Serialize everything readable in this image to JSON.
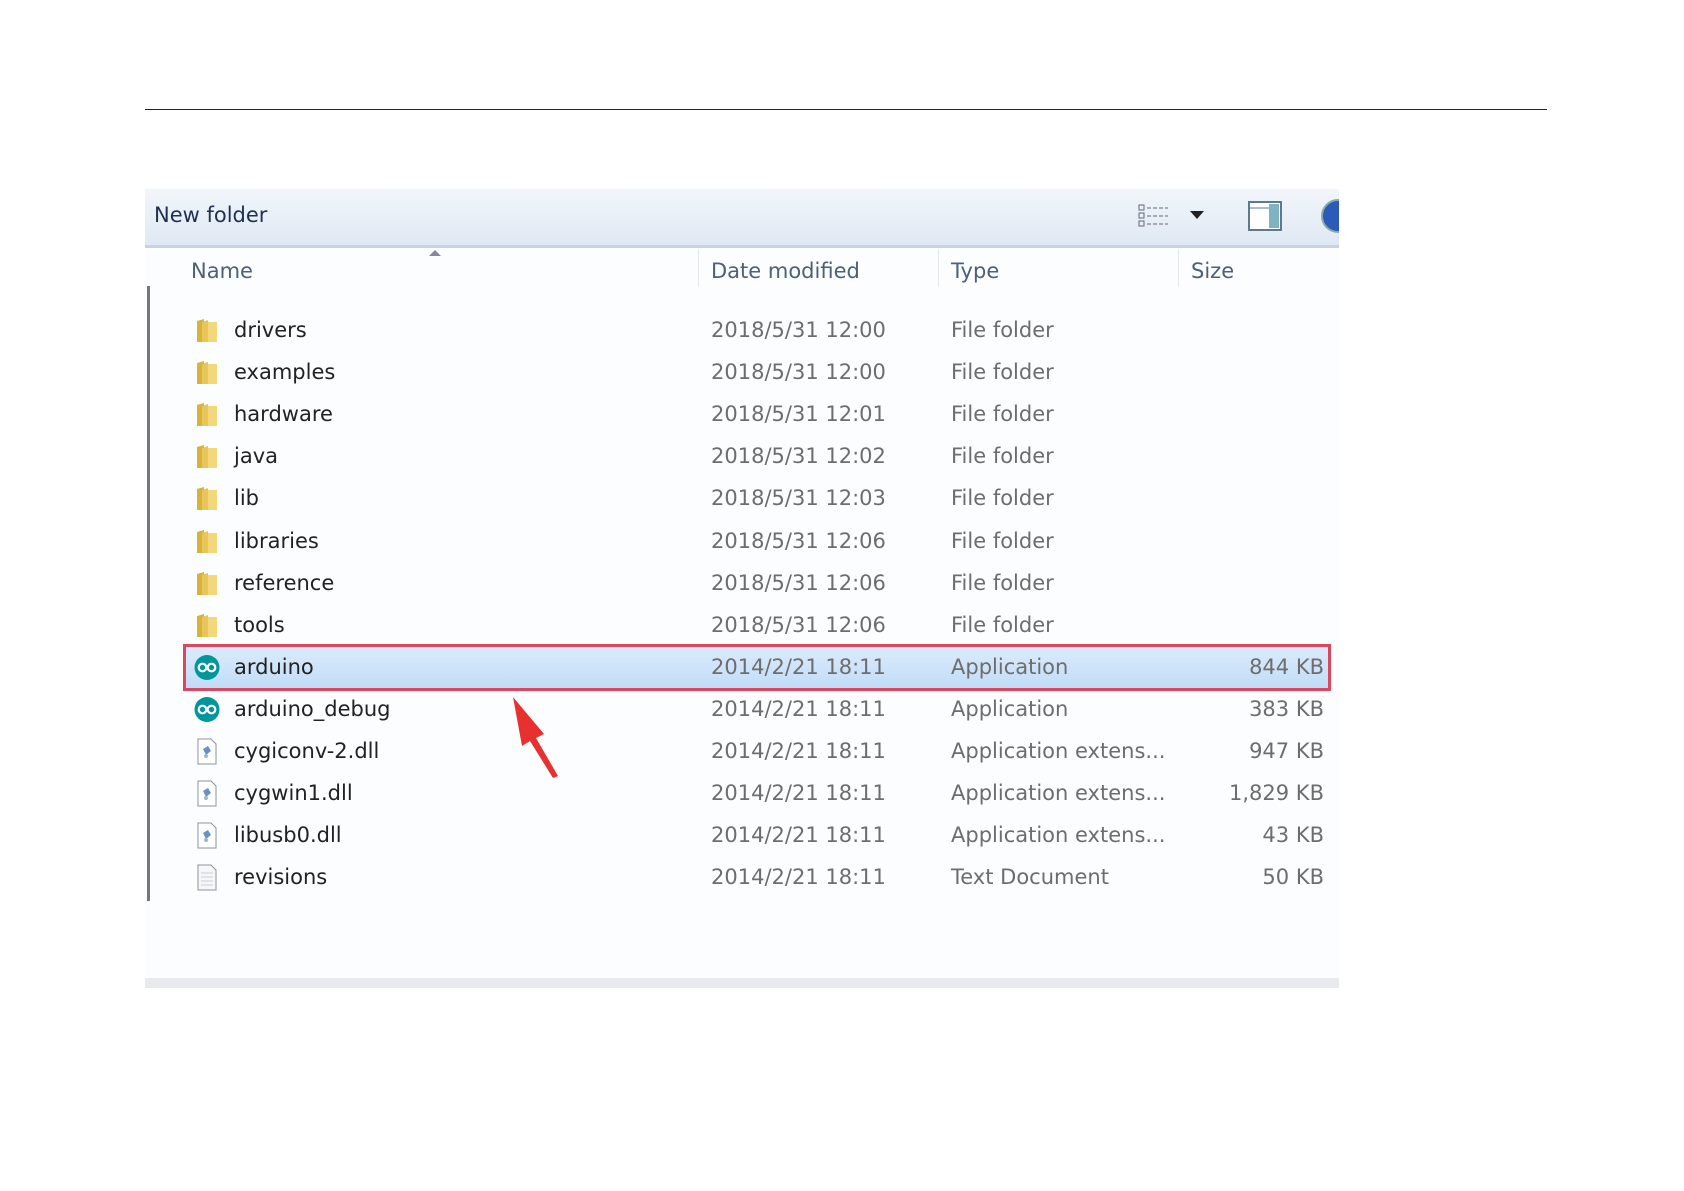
{
  "window": {
    "title": "New folder"
  },
  "columns": {
    "name": "Name",
    "date": "Date modified",
    "type": "Type",
    "size": "Size"
  },
  "files": [
    {
      "name": "drivers",
      "date": "2018/5/31 12:00",
      "type": "File folder",
      "size": "",
      "icon": "folder"
    },
    {
      "name": "examples",
      "date": "2018/5/31 12:00",
      "type": "File folder",
      "size": "",
      "icon": "folder"
    },
    {
      "name": "hardware",
      "date": "2018/5/31 12:01",
      "type": "File folder",
      "size": "",
      "icon": "folder"
    },
    {
      "name": "java",
      "date": "2018/5/31 12:02",
      "type": "File folder",
      "size": "",
      "icon": "folder"
    },
    {
      "name": "lib",
      "date": "2018/5/31 12:03",
      "type": "File folder",
      "size": "",
      "icon": "folder"
    },
    {
      "name": "libraries",
      "date": "2018/5/31 12:06",
      "type": "File folder",
      "size": "",
      "icon": "folder"
    },
    {
      "name": "reference",
      "date": "2018/5/31 12:06",
      "type": "File folder",
      "size": "",
      "icon": "folder"
    },
    {
      "name": "tools",
      "date": "2018/5/31 12:06",
      "type": "File folder",
      "size": "",
      "icon": "folder"
    },
    {
      "name": "arduino",
      "date": "2014/2/21 18:11",
      "type": "Application",
      "size": "844 KB",
      "icon": "arduino",
      "selected": true
    },
    {
      "name": "arduino_debug",
      "date": "2014/2/21 18:11",
      "type": "Application",
      "size": "383 KB",
      "icon": "arduino"
    },
    {
      "name": "cygiconv-2.dll",
      "date": "2014/2/21 18:11",
      "type": "Application extens...",
      "size": "947 KB",
      "icon": "dll"
    },
    {
      "name": "cygwin1.dll",
      "date": "2014/2/21 18:11",
      "type": "Application extens...",
      "size": "1,829 KB",
      "icon": "dll"
    },
    {
      "name": "libusb0.dll",
      "date": "2014/2/21 18:11",
      "type": "Application extens...",
      "size": "43 KB",
      "icon": "dll"
    },
    {
      "name": "revisions",
      "date": "2014/2/21 18:11",
      "type": "Text Document",
      "size": "50 KB",
      "icon": "text"
    }
  ],
  "colors": {
    "highlight": "#d9485f",
    "arrow": "#e8312f",
    "arduino": "#00979c"
  }
}
